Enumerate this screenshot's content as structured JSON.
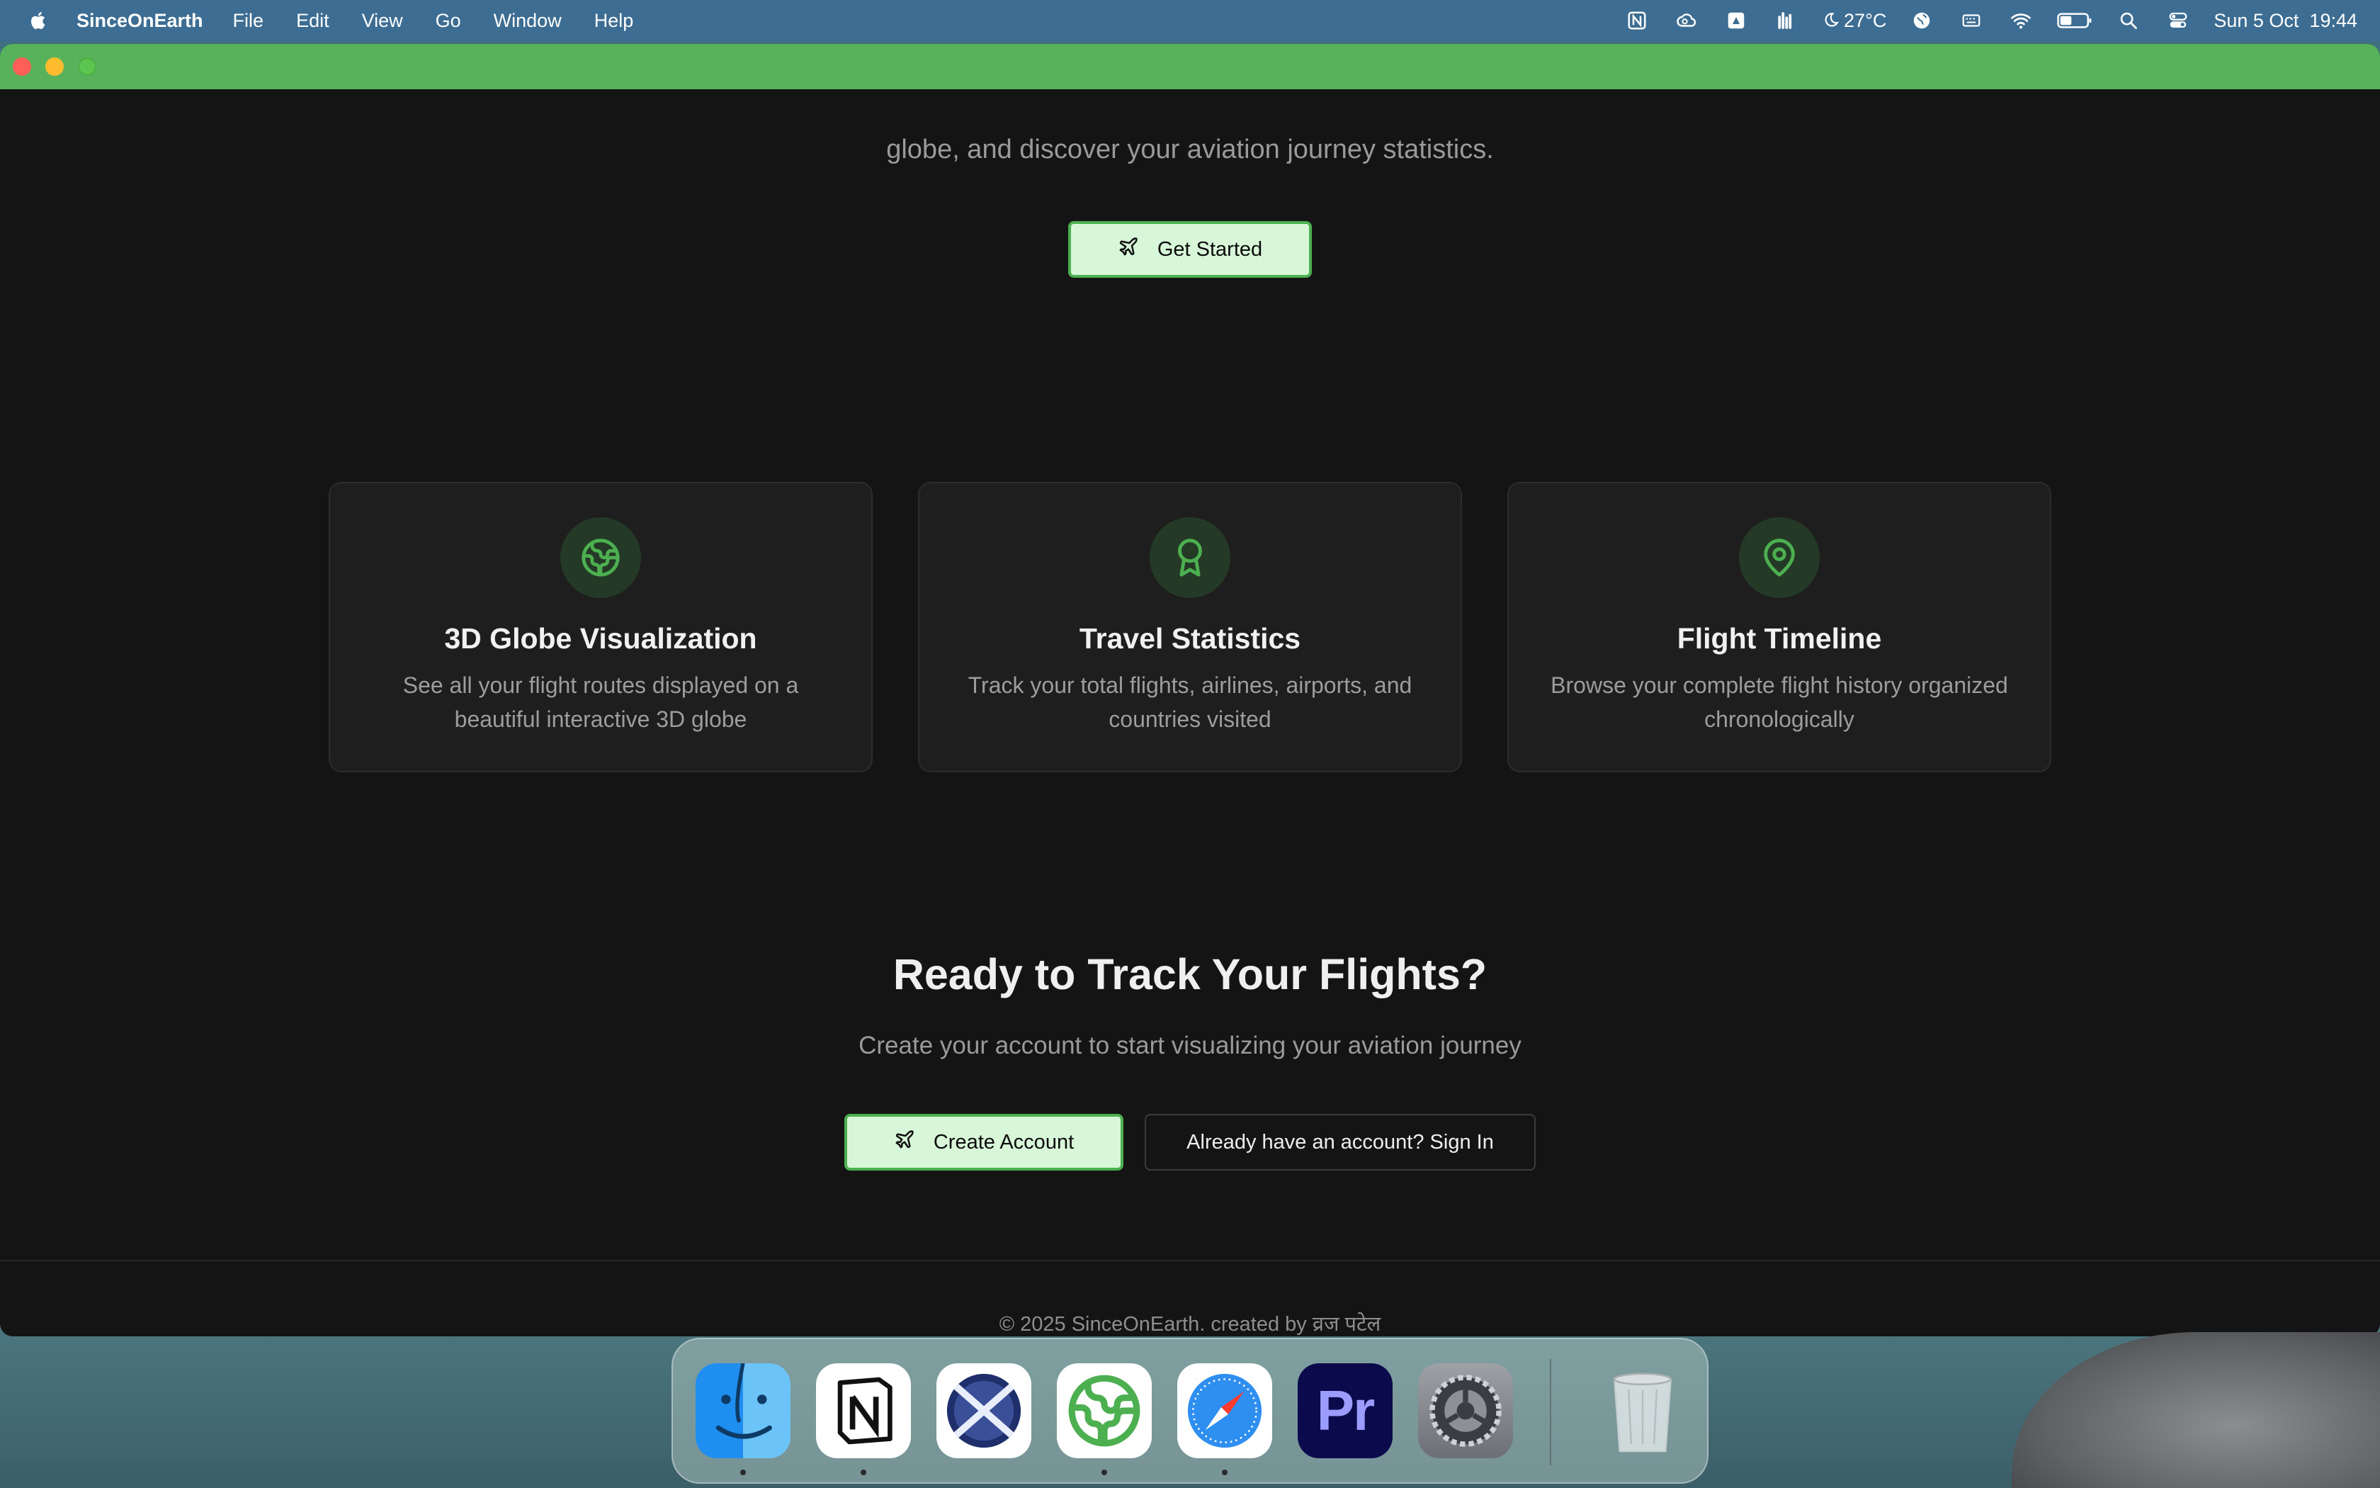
{
  "menubar": {
    "apple_icon": "apple-logo-icon",
    "app_name": "SinceOnEarth",
    "items": [
      "File",
      "Edit",
      "View",
      "Go",
      "Window",
      "Help"
    ],
    "status_icons": [
      "notion-icon",
      "creative-cloud-icon",
      "google-drive-icon",
      "audio-bars-icon",
      "weather-icon",
      "globe-icon",
      "keyboard-input-icon",
      "wifi-icon",
      "battery-icon",
      "search-icon",
      "control-center-icon"
    ],
    "weather": "27°C",
    "datetime": "Sun 5 Oct  19:44"
  },
  "window": {
    "titlebar_color": "#58b25b",
    "hero": {
      "subtitle_tail": "globe, and discover your aviation journey statistics.",
      "get_started_label": "Get Started"
    },
    "features": [
      {
        "icon": "globe-icon",
        "title": "3D Globe Visualization",
        "description": "See all your flight routes displayed on a beautiful interactive 3D globe"
      },
      {
        "icon": "award-icon",
        "title": "Travel Statistics",
        "description": "Track your total flights, airlines, airports, and countries visited"
      },
      {
        "icon": "map-pin-icon",
        "title": "Flight Timeline",
        "description": "Browse your complete flight history organized chronologically"
      }
    ],
    "cta": {
      "title": "Ready to Track Your Flights?",
      "subtitle": "Create your account to start visualizing your aviation journey",
      "create_account_label": "Create Account",
      "sign_in_label": "Already have an account? Sign In"
    },
    "footer": {
      "text": "© 2025 SinceOnEarth. created by व्रज पटेल"
    }
  },
  "dock": {
    "apps": [
      "Finder",
      "Notion",
      "Xcode Instruments",
      "SinceOnEarth",
      "Safari",
      "Premiere Pro",
      "System Settings",
      "Trash"
    ]
  },
  "colors": {
    "accent": "#4caf50",
    "button_fill": "#d8f7d8",
    "background": "#141414",
    "card": "#1e1e1e"
  }
}
